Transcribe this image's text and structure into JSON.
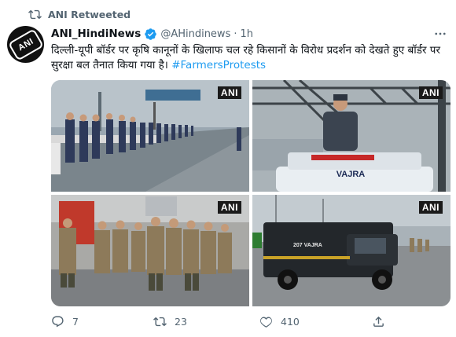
{
  "retweet_banner": {
    "label": "ANI Retweeted",
    "icon": "retweet-icon"
  },
  "author": {
    "display_name": "ANI_HindiNews",
    "handle": "@AHindinews",
    "separator": "·",
    "time": "1h",
    "verified": true,
    "avatar_logo_text": "ANI"
  },
  "tweet": {
    "text": "दिल्ली-यूपी बॉर्डर पर कृषि कानूनों के खिलाफ चल रहे किसानों के विरोध प्रदर्शन को देखते हुए बॉर्डर पर सुरक्षा बल तैनात किया गया है। ",
    "hashtag": "#FarmersProtests"
  },
  "media": {
    "watermark": "ANI",
    "photos": [
      {
        "watermark": "ANI",
        "subject": "row of security personnel along road barricades"
      },
      {
        "watermark": "ANI",
        "subject": "officer standing on vehicle under highway gantry",
        "vehicle_text": "VAJRA"
      },
      {
        "watermark": "ANI",
        "subject": "group of police officers with lathis on road"
      },
      {
        "watermark": "ANI",
        "subject": "black armoured police vehicle on highway",
        "vehicle_text": "207 VAJRA"
      }
    ]
  },
  "actions": {
    "reply_count": "7",
    "retweet_count": "23",
    "like_count": "410"
  },
  "colors": {
    "accent": "#1d9bf0",
    "secondary_text": "#536471",
    "primary_text": "#0f1419"
  }
}
